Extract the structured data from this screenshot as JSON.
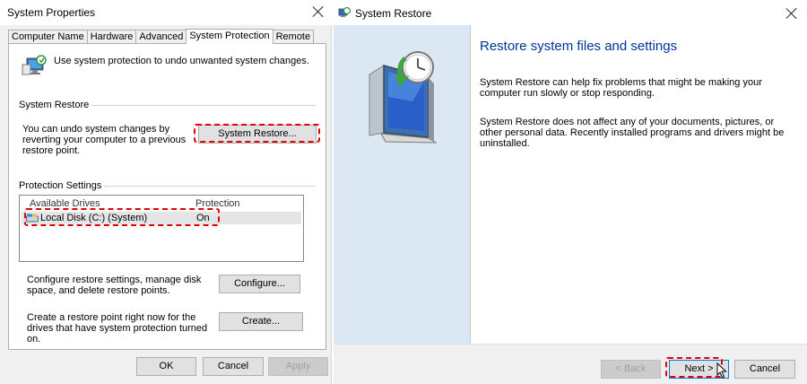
{
  "system_properties": {
    "title": "System Properties",
    "tabs": [
      "Computer Name",
      "Hardware",
      "Advanced",
      "System Protection",
      "Remote"
    ],
    "active_tab": "System Protection",
    "intro_text": "Use system protection to undo unwanted system changes.",
    "system_restore": {
      "group_label": "System Restore",
      "description": "You can undo system changes by reverting your computer to a previous restore point.",
      "button_label": "System Restore..."
    },
    "protection_settings": {
      "group_label": "Protection Settings",
      "columns": [
        "Available Drives",
        "Protection"
      ],
      "drives": [
        {
          "name": "Local Disk (C:) (System)",
          "protection": "On"
        }
      ],
      "configure_text": "Configure restore settings, manage disk space, and delete restore points.",
      "configure_button": "Configure...",
      "create_text": "Create a restore point right now for the drives that have system protection turned on.",
      "create_button": "Create..."
    },
    "footer": {
      "ok": "OK",
      "cancel": "Cancel",
      "apply": "Apply"
    }
  },
  "system_restore_wizard": {
    "title": "System Restore",
    "heading": "Restore system files and settings",
    "paragraph1": "System Restore can help fix problems that might be making your computer run slowly or stop responding.",
    "paragraph2": "System Restore does not affect any of your documents, pictures, or other personal data. Recently installed programs and drivers might be uninstalled.",
    "buttons": {
      "back": "< Back",
      "next": "Next >",
      "cancel": "Cancel"
    }
  },
  "colors": {
    "highlight": "#e00000",
    "heading": "#003399",
    "left_pane": "#dbe8f3"
  }
}
